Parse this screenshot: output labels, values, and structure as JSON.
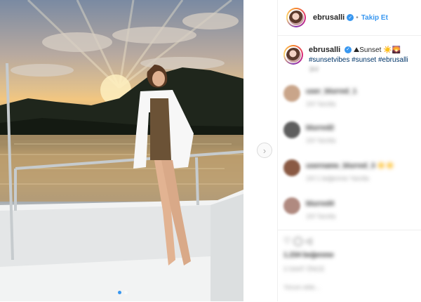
{
  "post": {
    "username": "ebrusalli",
    "follow_label": "Takip Et",
    "separator": "•",
    "caption_user": "ebrusalli",
    "caption_text": "⛰Sunset ☀️🌄",
    "hashtags": "#sunsetvibes #sunset #ebrusalli",
    "caption_meta": "3hf",
    "image_count": 2,
    "active_image": 1,
    "next_icon": "chevron-right-icon"
  },
  "comments": [
    {
      "user": "user_blurred_1",
      "meta": "1hf  Yanıtla"
    },
    {
      "user": "blurred2",
      "meta": "1hf  Yanıtla"
    },
    {
      "user": "username_blurred_3 ☀️☀️",
      "meta": "1hf  1 beğenme  Yanıtla"
    },
    {
      "user": "blurred4",
      "meta": "1hf  Yanıtla"
    }
  ],
  "footer": {
    "row1": "♡ ◯ ◁",
    "row2": "1.234 beğenme",
    "row3": "3 SAAT ÖNCE",
    "row4": "Yorum ekle..."
  },
  "colors": {
    "accent": "#3897f0",
    "text": "#262626",
    "muted": "#999999"
  }
}
